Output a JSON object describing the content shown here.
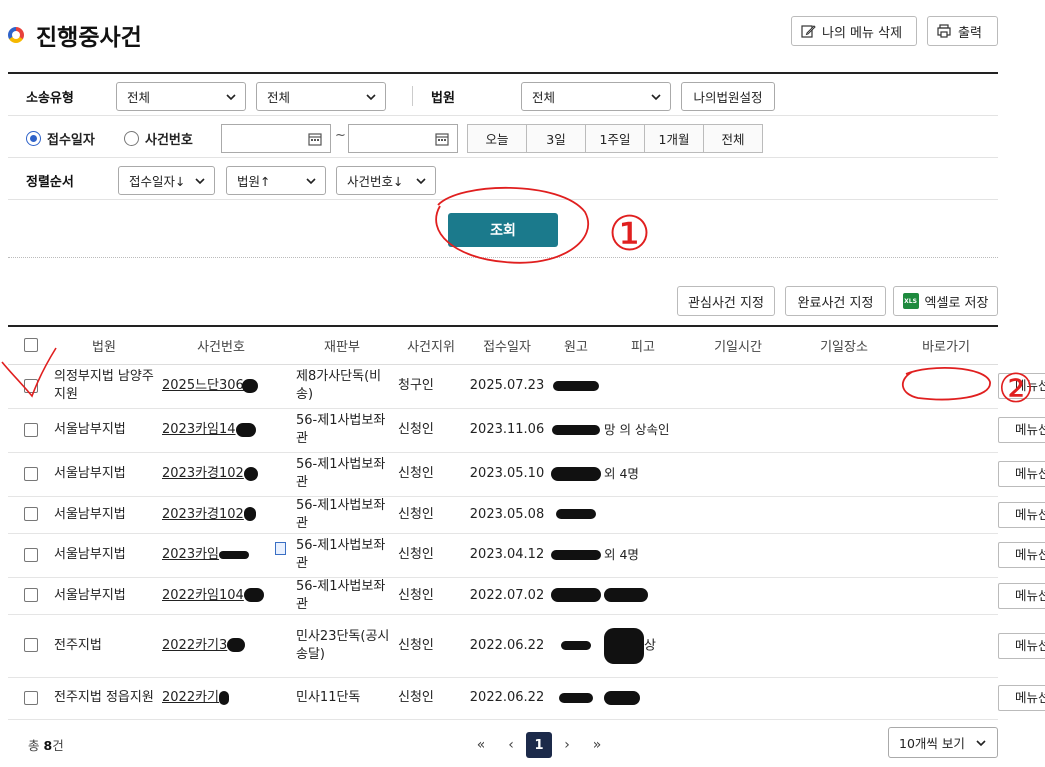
{
  "page": {
    "title": "진행중사건"
  },
  "top_buttons": {
    "delete_menu": "나의 메뉴 삭제",
    "print": "출력"
  },
  "search": {
    "case_type_label": "소송유형",
    "case_type_value1": "전체",
    "case_type_value2": "전체",
    "court_label": "법원",
    "court_value": "전체",
    "my_court_btn": "나의법원설정",
    "radio_receipt": "접수일자",
    "radio_case_no": "사건번호",
    "tilde": "~",
    "periods": [
      "오늘",
      "3일",
      "1주일",
      "1개월",
      "전체"
    ],
    "sort_label": "정렬순서",
    "sort1": "접수일자↓",
    "sort2": "법원↑",
    "sort3": "사건번호↓",
    "search_btn": "조회"
  },
  "actions": {
    "interest": "관심사건 지정",
    "complete": "완료사건 지정",
    "excel": "엑셀로 저장",
    "xls_badge": "XLS"
  },
  "table": {
    "headers": [
      "법원",
      "사건번호",
      "재판부",
      "사건지위",
      "접수일자",
      "원고",
      "피고",
      "기일시간",
      "기일장소",
      "바로가기"
    ],
    "menu_label": "메뉴선택",
    "rows": [
      {
        "court": "의정부지법 남양주지원",
        "case_no": "2025느단306",
        "dept": "제8가사단독(비송)",
        "status": "청구인",
        "date": "2025.07.23",
        "defendant": ""
      },
      {
        "court": "서울남부지법",
        "case_no": "2023카임14",
        "dept": "56-제1사법보좌관",
        "status": "신청인",
        "date": "2023.11.06",
        "defendant": "망 의 상속인"
      },
      {
        "court": "서울남부지법",
        "case_no": "2023카경102",
        "dept": "56-제1사법보좌관",
        "status": "신청인",
        "date": "2023.05.10",
        "defendant": "외 4명"
      },
      {
        "court": "서울남부지법",
        "case_no": "2023카경102",
        "dept": "56-제1사법보좌관",
        "status": "신청인",
        "date": "2023.05.08",
        "defendant": ""
      },
      {
        "court": "서울남부지법",
        "case_no": "2023카임",
        "dept": "56-제1사법보좌관",
        "status": "신청인",
        "date": "2023.04.12",
        "defendant": "외 4명"
      },
      {
        "court": "서울남부지법",
        "case_no": "2022카임104",
        "dept": "56-제1사법보좌관",
        "status": "신청인",
        "date": "2022.07.02",
        "defendant": ""
      },
      {
        "court": "전주지법",
        "case_no": "2022카기3",
        "dept": "민사23단독(공시송달)",
        "status": "신청인",
        "date": "2022.06.22",
        "defendant": "상"
      },
      {
        "court": "전주지법 정읍지원",
        "case_no": "2022카기",
        "dept": "민사11단독",
        "status": "신청인",
        "date": "2022.06.22",
        "defendant": ""
      }
    ]
  },
  "footer": {
    "total_prefix": "총",
    "total_count": "8",
    "total_suffix": "건",
    "current_page": "1",
    "page_size": "10개씩 보기"
  },
  "annotations": {
    "mark1": "①",
    "mark2": "②"
  }
}
